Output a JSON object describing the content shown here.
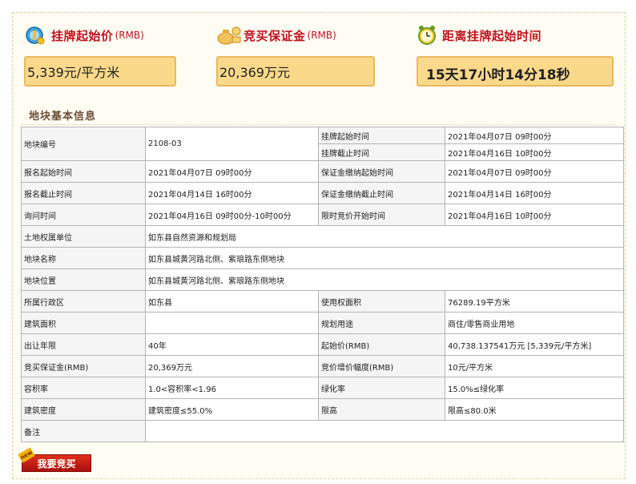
{
  "top": {
    "price": {
      "label": "挂牌起始价",
      "unit": "(RMB)",
      "value": "5,339元/平方米",
      "icon": "price-tag-icon"
    },
    "deposit": {
      "label": "竞买保证金",
      "unit": "(RMB)",
      "value": "20,369万元",
      "icon": "money-bag-icon"
    },
    "countdown": {
      "label": "距离挂牌起始时间",
      "value": "15天17小时14分18秒",
      "icon": "alarm-clock-icon"
    }
  },
  "section_title": "地块基本信息",
  "rows": [
    {
      "type": "split",
      "k1": "地块编号",
      "v1": "2108-03",
      "k2a": "挂牌起始时间",
      "v2a": "2021年04月07日 09时00分",
      "k2b": "挂牌截止时间",
      "v2b": "2021年04月16日 10时00分"
    },
    {
      "k1": "报名起始时间",
      "v1": "2021年04月07日 09时00分",
      "k2": "保证金缴纳起始时间",
      "v2": "2021年04月07日 09时00分"
    },
    {
      "k1": "报名截止时间",
      "v1": "2021年04月14日 16时00分",
      "k2": "保证金缴纳截止时间",
      "v2": "2021年04月14日 16时00分"
    },
    {
      "k1": "询问时间",
      "v1": "2021年04月16日 09时00分-10时00分",
      "k2": "限时竞价开始时间",
      "v2": "2021年04月16日 10时00分"
    },
    {
      "type": "wide",
      "k1": "土地权属单位",
      "v1": "如东县自然资源和规划局"
    },
    {
      "type": "wide",
      "k1": "地块名称",
      "v1": "如东县城黄河路北侧、紫琅路东侧地块"
    },
    {
      "type": "wide",
      "k1": "地块位置",
      "v1": "如东县城黄河路北侧、紫琅路东侧地块"
    },
    {
      "k1": "所属行政区",
      "v1": "如东县",
      "k2": "使用权面积",
      "v2": "76289.19平方米"
    },
    {
      "k1": "建筑面积",
      "v1": "",
      "k2": "规划用途",
      "v2": "商住/零售商业用地"
    },
    {
      "k1": "出让年限",
      "v1": "40年",
      "k2": "起始价(RMB)",
      "v2": "40,738.137541万元 [5,339元/平方米]"
    },
    {
      "k1": "竞买保证金(RMB)",
      "v1": "20,369万元",
      "k2": "竞价增价幅度(RMB)",
      "v2": "10元/平方米"
    },
    {
      "k1": "容积率",
      "v1": "1.0<容积率<1.96",
      "k2": "绿化率",
      "v2": "15.0%≤绿化率"
    },
    {
      "k1": "建筑密度",
      "v1": "建筑密度≤55.0%",
      "k2": "限高",
      "v2": "限高≤80.0米"
    },
    {
      "type": "wide",
      "k1": "备注",
      "v1": ""
    }
  ],
  "bid_button": {
    "label": "我要竞买",
    "tag": "new"
  },
  "colors": {
    "label_red": "#c1121f",
    "box_fill": "#fbd98b",
    "box_border": "#eab85f",
    "button_red": "#c4200f"
  }
}
